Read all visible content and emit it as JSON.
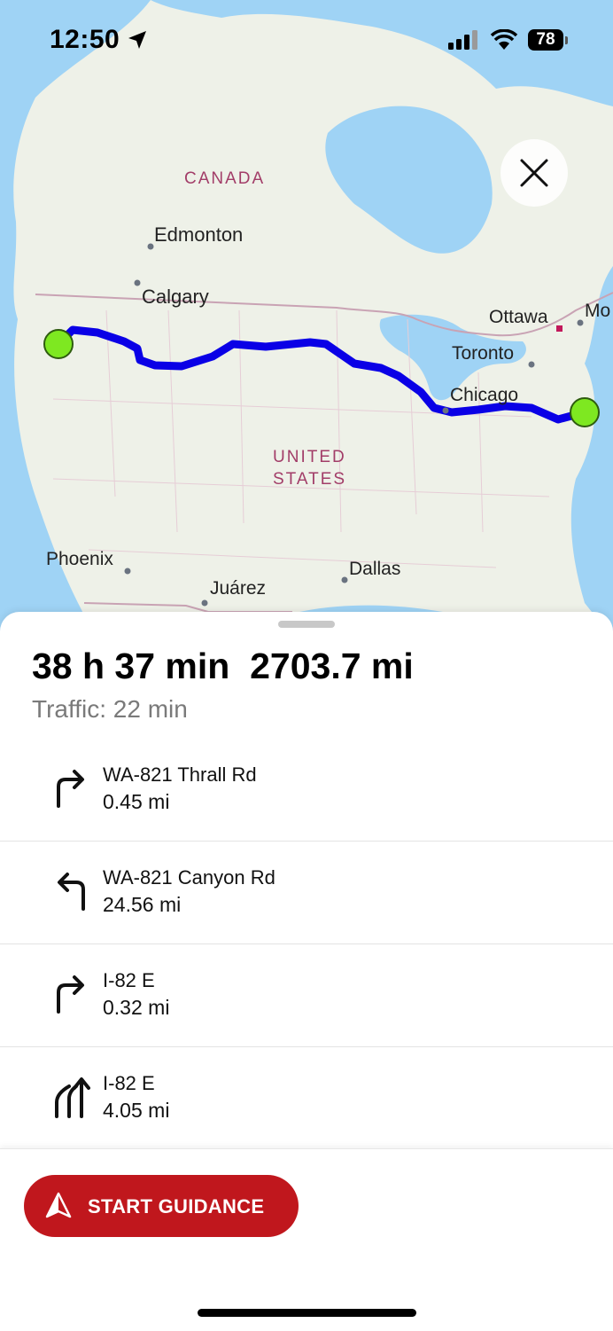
{
  "status_bar": {
    "time": "12:50",
    "battery": "78",
    "icons": [
      "location-arrow-icon",
      "cellular-signal-icon",
      "wifi-icon",
      "battery-icon"
    ]
  },
  "map": {
    "labels": {
      "canada": "CANADA",
      "united_states_line1": "UNITED",
      "united_states_line2": "STATES",
      "edmonton": "Edmonton",
      "calgary": "Calgary",
      "ottawa": "Ottawa",
      "montreal": "Mo",
      "toronto": "Toronto",
      "chicago": "Chicago",
      "phoenix": "Phoenix",
      "dallas": "Dallas",
      "juarez": "Juárez"
    },
    "colors": {
      "water": "#9fd3f5",
      "land": "#eef1e8",
      "route": "#0a00e6",
      "endpoint": "#7ee821"
    }
  },
  "route_summary": {
    "duration": "38 h 37 min",
    "distance": "2703.7 mi",
    "traffic": "Traffic: 22 min"
  },
  "steps": [
    {
      "icon": "turn-right-icon",
      "road": "WA-821 Thrall Rd",
      "distance": "0.45 mi"
    },
    {
      "icon": "turn-left-icon",
      "road": "WA-821 Canyon Rd",
      "distance": "24.56 mi"
    },
    {
      "icon": "turn-right-icon",
      "road": "I-82 E",
      "distance": "0.32 mi"
    },
    {
      "icon": "merge-lanes-icon",
      "road": "I-82 E",
      "distance": "4.05 mi"
    }
  ],
  "start_button": {
    "label": "START GUIDANCE",
    "color": "#c0171d"
  }
}
